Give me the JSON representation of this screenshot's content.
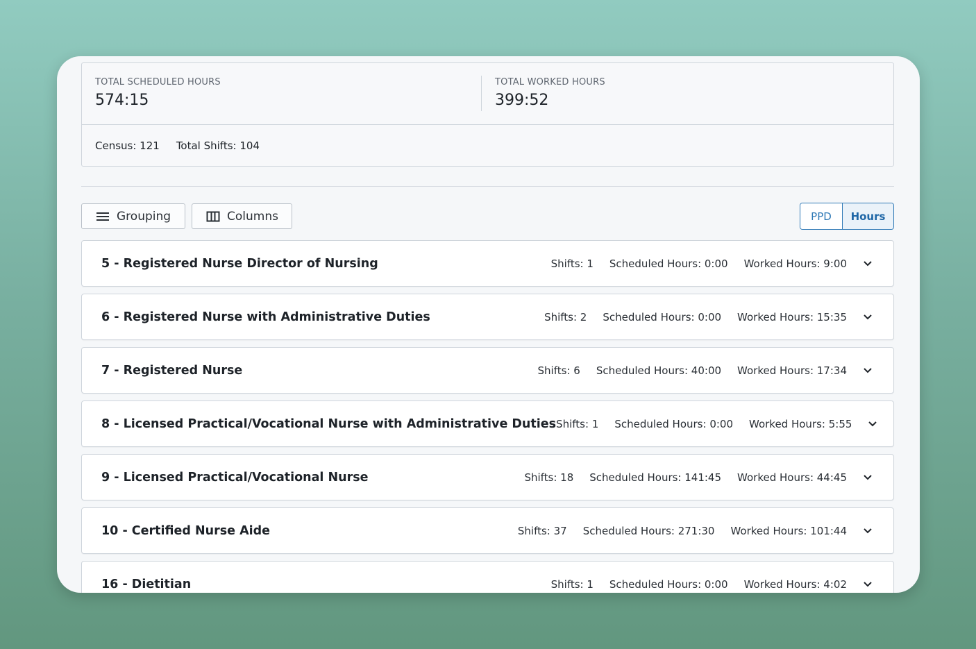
{
  "summary": {
    "scheduled_label": "TOTAL SCHEDULED HOURS",
    "scheduled_value": "574:15",
    "worked_label": "TOTAL WORKED HOURS",
    "worked_value": "399:52",
    "census": "Census: 121",
    "total_shifts": "Total Shifts: 104"
  },
  "toolbar": {
    "grouping_label": "Grouping",
    "columns_label": "Columns",
    "toggle": {
      "ppd_label": "PPD",
      "hours_label": "Hours",
      "selected": "Hours"
    }
  },
  "colors": {
    "accent": "#2f79b6",
    "background_top": "#91cbc0",
    "background_bottom": "#62977f"
  },
  "groups": [
    {
      "title": "5 - Registered Nurse Director of Nursing",
      "shifts": "Shifts: 1",
      "scheduled": "Scheduled Hours: 0:00",
      "worked": "Worked Hours: 9:00"
    },
    {
      "title": "6 - Registered Nurse with Administrative Duties",
      "shifts": "Shifts: 2",
      "scheduled": "Scheduled Hours: 0:00",
      "worked": "Worked Hours: 15:35"
    },
    {
      "title": "7 - Registered Nurse",
      "shifts": "Shifts: 6",
      "scheduled": "Scheduled Hours: 40:00",
      "worked": "Worked Hours: 17:34"
    },
    {
      "title": "8 - Licensed Practical/Vocational Nurse with Administrative Duties",
      "shifts": "Shifts: 1",
      "scheduled": "Scheduled Hours: 0:00",
      "worked": "Worked Hours: 5:55"
    },
    {
      "title": "9 - Licensed Practical/Vocational Nurse",
      "shifts": "Shifts: 18",
      "scheduled": "Scheduled Hours: 141:45",
      "worked": "Worked Hours: 44:45"
    },
    {
      "title": "10 - Certified Nurse Aide",
      "shifts": "Shifts: 37",
      "scheduled": "Scheduled Hours: 271:30",
      "worked": "Worked Hours: 101:44"
    },
    {
      "title": "16 - Dietitian",
      "shifts": "Shifts: 1",
      "scheduled": "Scheduled Hours: 0:00",
      "worked": "Worked Hours: 4:02"
    }
  ]
}
